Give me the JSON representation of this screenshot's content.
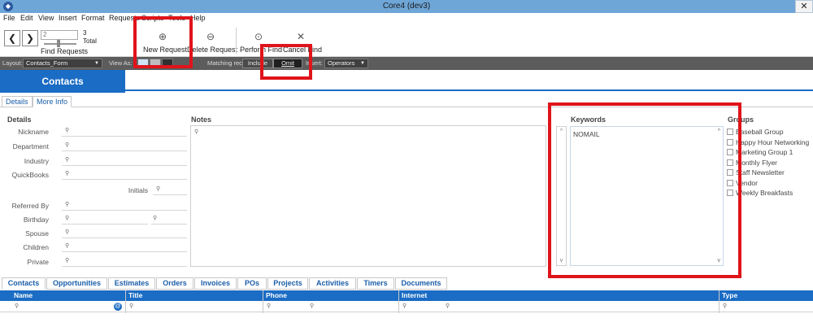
{
  "window": {
    "title": "Core4 (dev3)",
    "close_glyph": "✕"
  },
  "menu": [
    "File",
    "Edit",
    "View",
    "Insert",
    "Format",
    "Requests",
    "Scripts",
    "Tools",
    "Help"
  ],
  "toolbar": {
    "prev_glyph": "❮",
    "next_glyph": "❯",
    "record_number": "2",
    "total_count": "3",
    "total_label": "Total",
    "find_requests_label": "Find Requests",
    "new_request_label": "New Request",
    "delete_request_label": "Delete Request",
    "perform_find_label": "Perform Find",
    "cancel_find_label": "Cancel Find"
  },
  "layoutbar": {
    "layout_label": "Layout:",
    "layout_value": "Contacts_Form",
    "view_as_label": "View As:",
    "matching_label": "Matching records:",
    "include_label": "Include",
    "omit_label": "Omit",
    "insert_label": "Insert:",
    "insert_value": "Operators"
  },
  "header": {
    "title": "Contacts"
  },
  "subtabs": [
    "Details",
    "More Info"
  ],
  "details": {
    "heading": "Details",
    "fields": [
      "Nickname",
      "Department",
      "Industry",
      "QuickBooks"
    ],
    "initials_label": "Initials",
    "fields2": [
      "Referred By",
      "Birthday",
      "Spouse",
      "Children",
      "Private"
    ]
  },
  "notes": {
    "heading": "Notes"
  },
  "keywords": {
    "heading": "Keywords",
    "values": [
      "NOMAIL"
    ]
  },
  "groups": {
    "heading": "Groups",
    "items": [
      "Baseball Group",
      "Happy Hour Networking",
      "Marketing Group 1",
      "Monthly Flyer",
      "Staff Newsletter",
      "Vendor",
      "Weekly Breakfasts"
    ]
  },
  "portal_tabs": [
    "Contacts",
    "Opportunities",
    "Estimates",
    "Orders",
    "Invoices",
    "POs",
    "Projects",
    "Activities",
    "Timers",
    "Documents"
  ],
  "portal_columns": [
    "Name",
    "Title",
    "Phone",
    "Internet",
    "Type"
  ],
  "icons": {
    "search": "⚲",
    "new_request": "⊕",
    "delete_request": "⊖",
    "perform_find": "⊙",
    "cancel_find": "✕",
    "up": "^",
    "down": "v",
    "dropdown": "▼",
    "globe": "@"
  },
  "colors": {
    "accent_blue": "#1b6cc4",
    "highlight_red": "#e0141b",
    "titlebar": "#6fa6d8"
  }
}
